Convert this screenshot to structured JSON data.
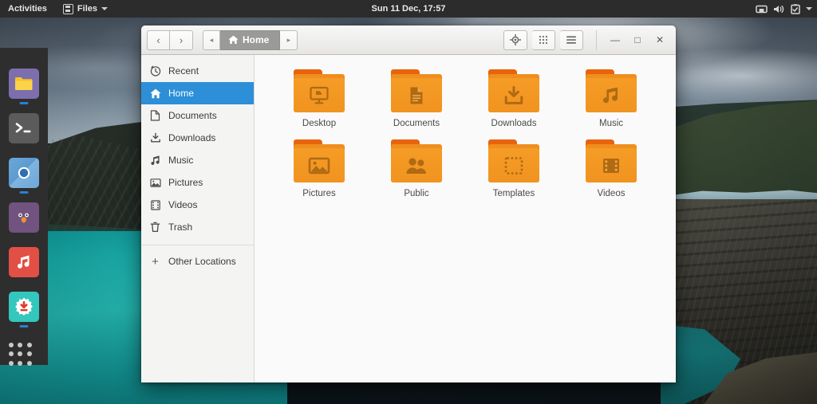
{
  "topbar": {
    "activities": "Activities",
    "app_menu": "Files",
    "app_menu_icon": "files-app-icon",
    "clock": "Sun 11 Dec, 17:57",
    "indicators": [
      {
        "name": "network-icon",
        "glyph": "network"
      },
      {
        "name": "volume-icon",
        "glyph": "volume"
      },
      {
        "name": "battery-icon",
        "glyph": "battery"
      },
      {
        "name": "chevron-down-icon",
        "glyph": "caret"
      }
    ],
    "bg": "#2c2c2c"
  },
  "dock": {
    "bg": "#2e2e2e",
    "running_indicator_color": "#2a7fd4",
    "items": [
      {
        "name": "dock-item-files",
        "label": "Files",
        "icon": "files-icon",
        "bg": "#7d6fae",
        "running": true
      },
      {
        "name": "dock-item-terminal",
        "label": "Terminal",
        "icon": "terminal-icon",
        "bg": "#5b5b5b",
        "running": false
      },
      {
        "name": "dock-item-web-browser",
        "label": "Web Browser",
        "icon": "browser-icon",
        "bg": "#5f9bd0",
        "running": true
      },
      {
        "name": "dock-item-mail",
        "label": "Mail",
        "icon": "bird-mail-icon",
        "bg": "#70537f",
        "running": false
      },
      {
        "name": "dock-item-music",
        "label": "Music",
        "icon": "music-note-icon",
        "bg": "#e24f45",
        "running": false
      },
      {
        "name": "dock-item-software",
        "label": "Software",
        "icon": "software-download-icon",
        "bg": "#34c7bd",
        "running": true
      }
    ],
    "show_apps": {
      "name": "show-applications-button",
      "label": "Show Applications",
      "icon": "app-grid-icon"
    }
  },
  "window": {
    "title": "Home",
    "header": {
      "back_label": "‹",
      "forward_label": "›",
      "path_prev": "◂",
      "path_next": "▸",
      "crumb_label": "Home",
      "crumb_icon": "home-icon",
      "location_label": "Search / Location",
      "location_icon": "location-target-icon",
      "view_label": "View Options",
      "view_icon": "grid-view-icon",
      "menu_label": "Menu",
      "menu_icon": "hamburger-menu-icon",
      "minimize_label": "—",
      "maximize_label": "□",
      "close_label": "✕"
    },
    "sidebar": {
      "items": [
        {
          "label": "Recent",
          "icon": "clock-icon",
          "active": false
        },
        {
          "label": "Home",
          "icon": "home-icon",
          "active": true
        },
        {
          "label": "Documents",
          "icon": "document-icon",
          "active": false
        },
        {
          "label": "Downloads",
          "icon": "download-icon",
          "active": false
        },
        {
          "label": "Music",
          "icon": "music-note-icon",
          "active": false
        },
        {
          "label": "Pictures",
          "icon": "picture-icon",
          "active": false
        },
        {
          "label": "Videos",
          "icon": "film-icon",
          "active": false
        },
        {
          "label": "Trash",
          "icon": "trash-icon",
          "active": false
        }
      ],
      "other_locations": {
        "label": "Other Locations",
        "icon": "plus-icon"
      },
      "selected_color": "#2c8fd8"
    },
    "files": [
      {
        "label": "Desktop",
        "emblem": "desktop-monitor-icon"
      },
      {
        "label": "Documents",
        "emblem": "document-icon"
      },
      {
        "label": "Downloads",
        "emblem": "download-arrow-icon"
      },
      {
        "label": "Music",
        "emblem": "music-note-icon"
      },
      {
        "label": "Pictures",
        "emblem": "image-icon"
      },
      {
        "label": "Public",
        "emblem": "people-icon"
      },
      {
        "label": "Templates",
        "emblem": "dashed-square-icon"
      },
      {
        "label": "Videos",
        "emblem": "film-strip-icon"
      }
    ],
    "folder_colors": {
      "body": "#f59c26",
      "tab": "#e8640c",
      "emblem": "#b06a12"
    }
  }
}
